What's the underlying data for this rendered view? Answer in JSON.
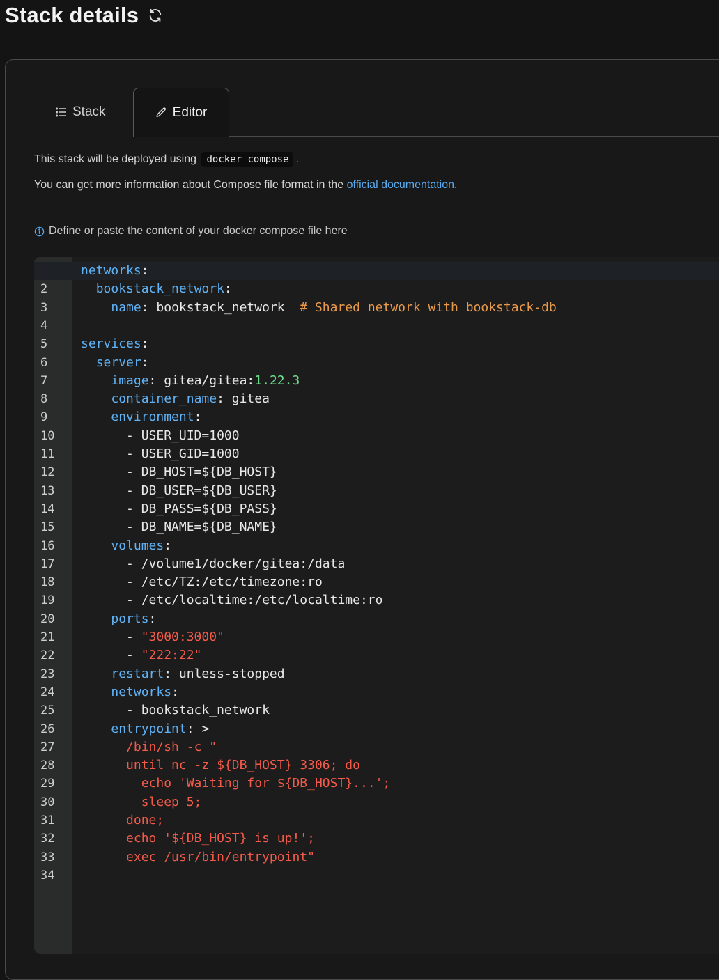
{
  "header": {
    "title": "Stack details",
    "refresh_icon": "refresh-icon"
  },
  "tabs": [
    {
      "label": "Stack",
      "icon": "list-icon",
      "active": false
    },
    {
      "label": "Editor",
      "icon": "pencil-icon",
      "active": true
    }
  ],
  "info": {
    "line1_prefix": "This stack will be deployed using",
    "line1_code": "docker compose",
    "line1_suffix": ".",
    "line2_prefix": "You can get more information about Compose file format in the",
    "line2_link": "official documentation",
    "line2_suffix": "."
  },
  "hint": {
    "text": "Define or paste the content of your docker compose file here",
    "icon": "info-circle-icon"
  },
  "colors": {
    "key": "#5fb2f5",
    "comment": "#e89a4c",
    "number": "#6fdc8c",
    "string": "#f35a4a",
    "link": "#58aaf0"
  },
  "editor": {
    "lines": [
      [
        {
          "t": "networks",
          "c": "k"
        },
        {
          "t": ":"
        }
      ],
      [
        {
          "t": "  "
        },
        {
          "t": "bookstack_network",
          "c": "k"
        },
        {
          "t": ":"
        }
      ],
      [
        {
          "t": "    "
        },
        {
          "t": "name",
          "c": "k"
        },
        {
          "t": ": bookstack_network  "
        },
        {
          "t": "# Shared network with bookstack-db",
          "c": "c"
        }
      ],
      [],
      [
        {
          "t": "services",
          "c": "k"
        },
        {
          "t": ":"
        }
      ],
      [
        {
          "t": "  "
        },
        {
          "t": "server",
          "c": "k"
        },
        {
          "t": ":"
        }
      ],
      [
        {
          "t": "    "
        },
        {
          "t": "image",
          "c": "k"
        },
        {
          "t": ": gitea/gitea:"
        },
        {
          "t": "1.22.3",
          "c": "n"
        }
      ],
      [
        {
          "t": "    "
        },
        {
          "t": "container_name",
          "c": "k"
        },
        {
          "t": ": gitea"
        }
      ],
      [
        {
          "t": "    "
        },
        {
          "t": "environment",
          "c": "k"
        },
        {
          "t": ":"
        }
      ],
      [
        {
          "t": "      - USER_UID=1000"
        }
      ],
      [
        {
          "t": "      - USER_GID=1000"
        }
      ],
      [
        {
          "t": "      - DB_HOST=${DB_HOST}"
        }
      ],
      [
        {
          "t": "      - DB_USER=${DB_USER}"
        }
      ],
      [
        {
          "t": "      - DB_PASS=${DB_PASS}"
        }
      ],
      [
        {
          "t": "      - DB_NAME=${DB_NAME}"
        }
      ],
      [
        {
          "t": "    "
        },
        {
          "t": "volumes",
          "c": "k"
        },
        {
          "t": ":"
        }
      ],
      [
        {
          "t": "      - /volume1/docker/gitea:/data"
        }
      ],
      [
        {
          "t": "      - /etc/TZ:/etc/timezone:ro"
        }
      ],
      [
        {
          "t": "      - /etc/localtime:/etc/localtime:ro"
        }
      ],
      [
        {
          "t": "    "
        },
        {
          "t": "ports",
          "c": "k"
        },
        {
          "t": ":"
        }
      ],
      [
        {
          "t": "      - "
        },
        {
          "t": "\"3000:3000\"",
          "c": "s"
        }
      ],
      [
        {
          "t": "      - "
        },
        {
          "t": "\"222:22\"",
          "c": "s"
        }
      ],
      [
        {
          "t": "    "
        },
        {
          "t": "restart",
          "c": "k"
        },
        {
          "t": ": unless-stopped"
        }
      ],
      [
        {
          "t": "    "
        },
        {
          "t": "networks",
          "c": "k"
        },
        {
          "t": ":"
        }
      ],
      [
        {
          "t": "      - bookstack_network"
        }
      ],
      [
        {
          "t": "    "
        },
        {
          "t": "entrypoint",
          "c": "k"
        },
        {
          "t": ": >"
        }
      ],
      [
        {
          "t": "      "
        },
        {
          "t": "/bin/sh -c \"",
          "c": "s"
        }
      ],
      [
        {
          "t": "      "
        },
        {
          "t": "until nc -z ${DB_HOST} 3306; do",
          "c": "s"
        }
      ],
      [
        {
          "t": "        "
        },
        {
          "t": "echo 'Waiting for ${DB_HOST}...';",
          "c": "s"
        }
      ],
      [
        {
          "t": "        "
        },
        {
          "t": "sleep 5;",
          "c": "s"
        }
      ],
      [
        {
          "t": "      "
        },
        {
          "t": "done;",
          "c": "s"
        }
      ],
      [
        {
          "t": "      "
        },
        {
          "t": "echo '${DB_HOST} is up!';",
          "c": "s"
        }
      ],
      [
        {
          "t": "      "
        },
        {
          "t": "exec /usr/bin/entrypoint\"",
          "c": "s"
        }
      ],
      []
    ]
  }
}
